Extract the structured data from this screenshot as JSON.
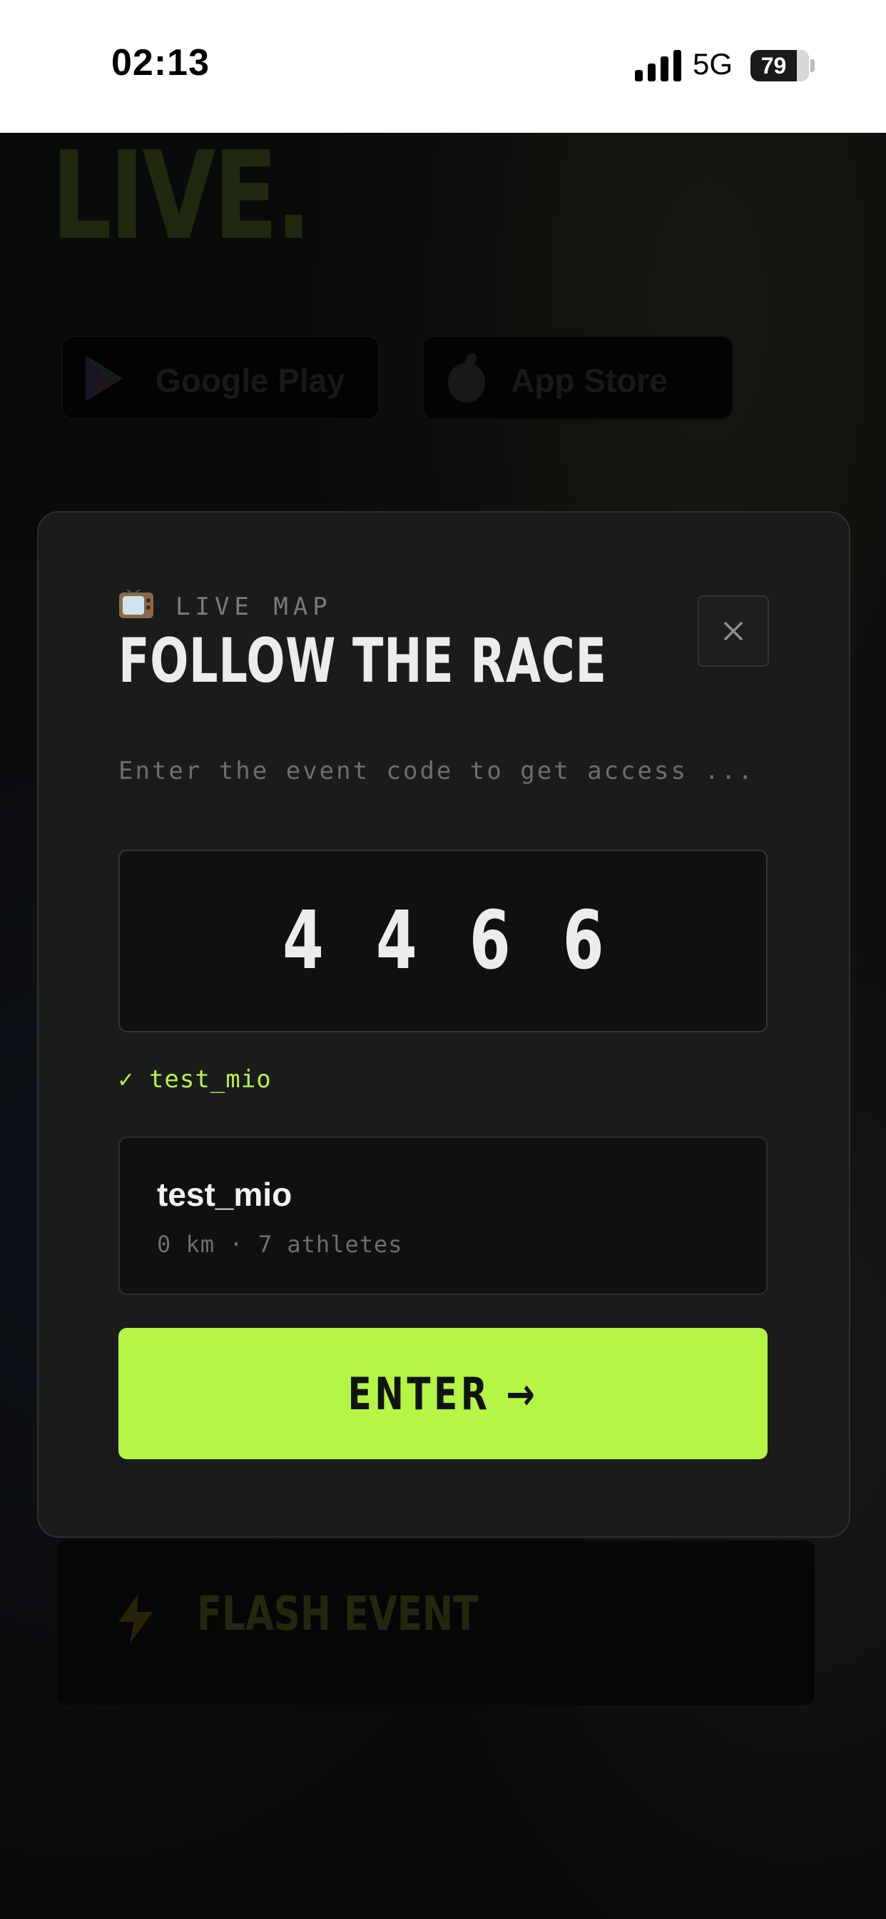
{
  "status_bar": {
    "time": "02:13",
    "network": "5G",
    "battery_level": "79"
  },
  "background_page": {
    "headline": "LIVE.",
    "google_play_label": "Google Play",
    "app_store_label": "App Store",
    "flash_event_label": "FLASH EVENT"
  },
  "modal": {
    "emoji": "📺",
    "kicker": "LIVE MAP",
    "title": "FOLLOW THE RACE",
    "instruction": "Enter the event code to get access ...",
    "code": "4466",
    "code_display": "4 4 6 6",
    "code_status": "✓ test_mio",
    "event": {
      "name": "test_mio",
      "meta": "0 km · 7 athletes"
    },
    "enter_label": "ENTER →",
    "close_icon": "close-icon"
  },
  "colors": {
    "accent": "#b5f545",
    "modal_bg": "#1a1b1b",
    "field_bg": "#0f1010",
    "text_primary": "#ececec",
    "text_muted": "#6d6e6d",
    "success": "#b6f24a"
  }
}
